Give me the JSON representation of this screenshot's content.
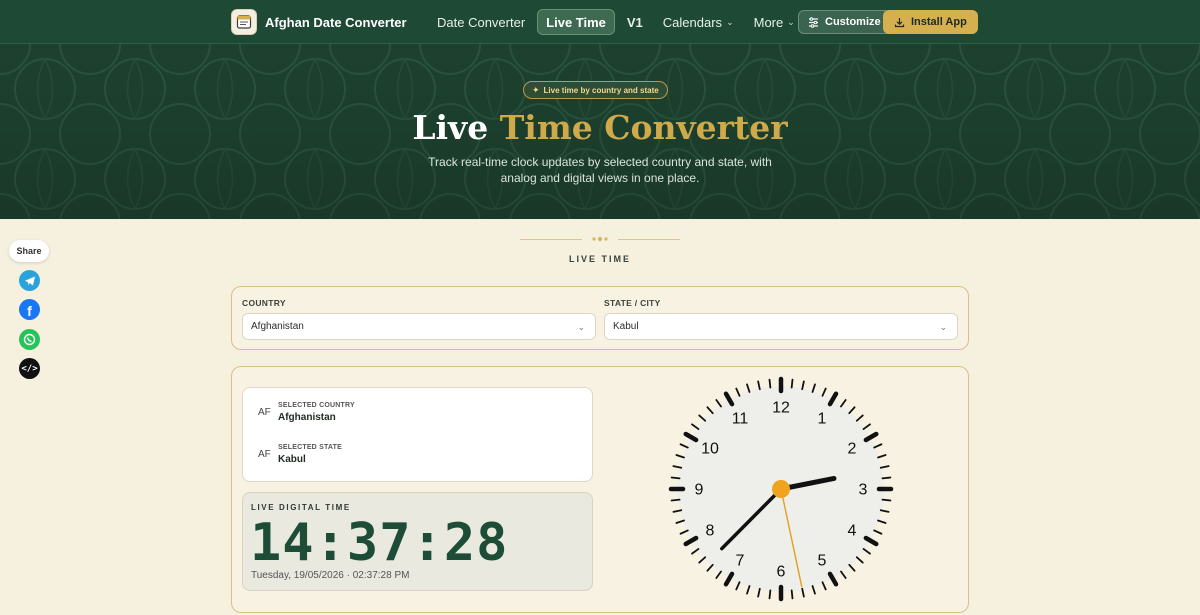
{
  "header": {
    "brand": "Afghan Date Converter",
    "nav": [
      {
        "label": "Date Converter"
      },
      {
        "label": "Live Time",
        "active": true
      },
      {
        "label": "V1"
      },
      {
        "label": "Calendars",
        "dropdown": true
      },
      {
        "label": "More",
        "dropdown": true
      }
    ],
    "customize_label": "Customize",
    "install_label": "Install App"
  },
  "hero": {
    "badge": "Live time by country and state",
    "title_part1": "Live",
    "title_part2": "Time Converter",
    "subtitle": "Track real-time clock updates by selected country and state, with analog and digital views in one place."
  },
  "share": {
    "label": "Share",
    "icons": [
      "telegram-icon",
      "facebook-icon",
      "whatsapp-icon",
      "embed-code-icon"
    ]
  },
  "section": {
    "label": "LIVE TIME"
  },
  "selectors": {
    "country_label": "COUNTRY",
    "country_value": "Afghanistan",
    "state_label": "STATE / CITY",
    "state_value": "Kabul"
  },
  "info": {
    "country_code": "AF",
    "country_caption": "SELECTED COUNTRY",
    "country_name": "Afghanistan",
    "state_code": "AF",
    "state_caption": "SELECTED STATE",
    "state_name": "Kabul"
  },
  "digital": {
    "label": "LIVE DIGITAL TIME",
    "time": "14:37:28",
    "date_line": "Tuesday, 19/05/2026 · 02:37:28 PM"
  },
  "clock": {
    "numbers": [
      "12",
      "1",
      "2",
      "3",
      "4",
      "5",
      "6",
      "7",
      "8",
      "9",
      "10",
      "11"
    ],
    "hour": 14,
    "minute": 37,
    "second": 28,
    "colors": {
      "face": "#eeeeea",
      "hands": "#111111",
      "second_hand": "#e2a021",
      "center": "#f0a31c"
    }
  },
  "colors": {
    "header_bg": "#1e4a35",
    "accent_gold": "#cfa94a",
    "page_bg": "#f6f0df"
  }
}
